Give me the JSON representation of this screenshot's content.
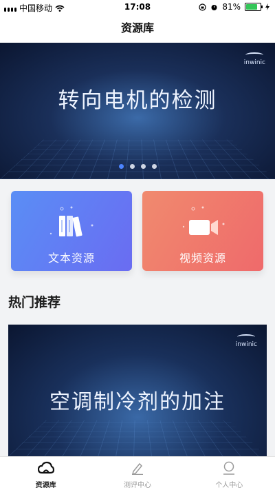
{
  "status_bar": {
    "carrier": "中国移动",
    "time": "17:08",
    "battery": "81%",
    "battery_level": 0.81,
    "icons": [
      "signal-icon",
      "wifi-icon",
      "lock-rotation-icon",
      "alarm-icon",
      "battery-icon",
      "charging-icon"
    ]
  },
  "nav": {
    "title": "资源库"
  },
  "banner": {
    "headline": "转向电机的检测",
    "logo_text": "inwinic",
    "slide_count": 4,
    "active_slide": 0
  },
  "cards": [
    {
      "label": "文本资源",
      "icon": "books-icon"
    },
    {
      "label": "视频资源",
      "icon": "video-camera-icon"
    }
  ],
  "section": {
    "title": "热门推荐"
  },
  "featured": {
    "headline": "空调制冷剂的加注",
    "logo_text": "inwinic"
  },
  "tabs": [
    {
      "label": "资源库",
      "icon": "cloud-icon",
      "active": true
    },
    {
      "label": "测评中心",
      "icon": "pencil-icon",
      "active": false
    },
    {
      "label": "个人中心",
      "icon": "user-icon",
      "active": false
    }
  ],
  "colors": {
    "accent": "#4c84ff",
    "card_text_start": "#5a8ef5",
    "card_text_end": "#6a6cf2",
    "card_video_start": "#f08a6e",
    "card_video_end": "#ef6a6b"
  }
}
